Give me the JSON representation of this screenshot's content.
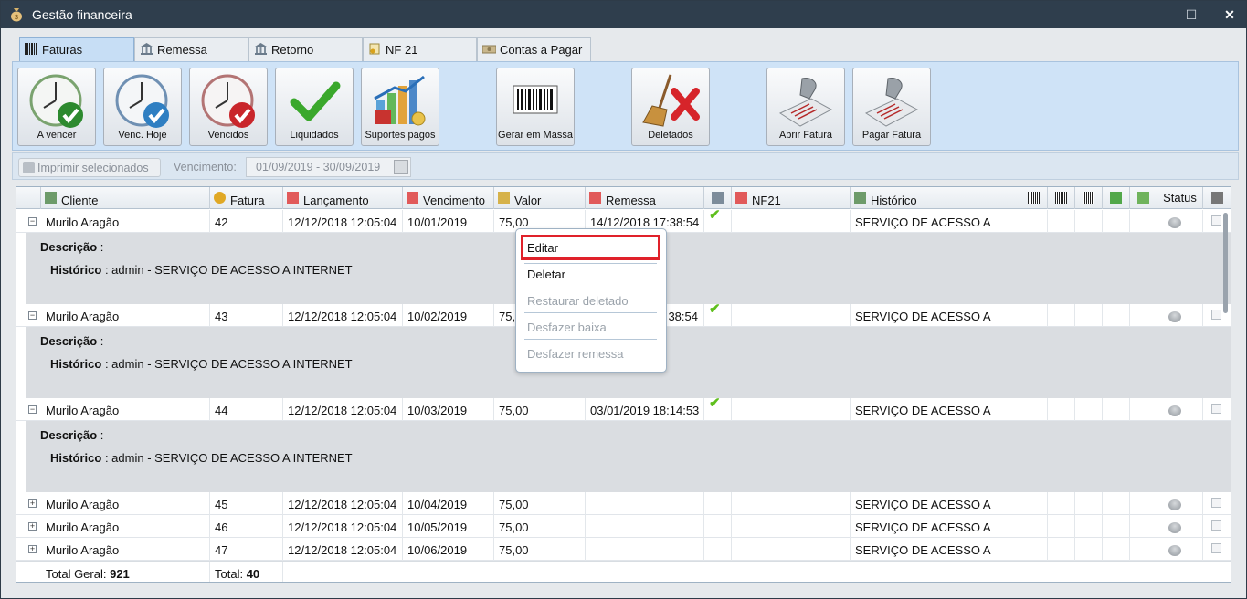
{
  "window": {
    "title": "Gestão financeira",
    "minimize": "—",
    "maximize": "☐",
    "close": "✕"
  },
  "tabs": [
    {
      "label": "Faturas",
      "active": true
    },
    {
      "label": "Remessa"
    },
    {
      "label": "Retorno"
    },
    {
      "label": "NF 21"
    },
    {
      "label": "Contas a Pagar"
    }
  ],
  "toolbar": {
    "a_vencer": "A vencer",
    "venc_hoje": "Venc. Hoje",
    "vencidos": "Vencidos",
    "liquidados": "Liquidados",
    "suportes_pagos": "Suportes pagos",
    "gerar_em_massa": "Gerar em Massa",
    "deletados": "Deletados",
    "abrir_fatura": "Abrir Fatura",
    "pagar_fatura": "Pagar Fatura"
  },
  "filter": {
    "print_label": "Imprimir selecionados",
    "vencimento_label": "Vencimento:",
    "vencimento_value": "01/09/2019 - 30/09/2019"
  },
  "columns": {
    "cliente": "Cliente",
    "fatura": "Fatura",
    "lancamento": "Lançamento",
    "vencimento": "Vencimento",
    "valor": "Valor",
    "remessa": "Remessa",
    "nf21": "NF21",
    "historico": "Histórico",
    "status": "Status"
  },
  "rows": [
    {
      "cliente": "Murilo Aragão",
      "fatura": "42",
      "lancamento": "12/12/2018 12:05:04",
      "vencimento": "10/01/2019",
      "valor": "75,00",
      "remessa": "14/12/2018 17:38:54",
      "historico": "SERVIÇO DE ACESSO A",
      "expanded": true
    },
    {
      "cliente": "Murilo Aragão",
      "fatura": "43",
      "lancamento": "12/12/2018 12:05:04",
      "vencimento": "10/02/2019",
      "valor": "75,",
      "remessa": "38:54",
      "historico": "SERVIÇO DE ACESSO A",
      "expanded": true
    },
    {
      "cliente": "Murilo Aragão",
      "fatura": "44",
      "lancamento": "12/12/2018 12:05:04",
      "vencimento": "10/03/2019",
      "valor": "75,00",
      "remessa": "03/01/2019 18:14:53",
      "historico": "SERVIÇO DE ACESSO A",
      "expanded": true
    },
    {
      "cliente": "Murilo Aragão",
      "fatura": "45",
      "lancamento": "12/12/2018 12:05:04",
      "vencimento": "10/04/2019",
      "valor": "75,00",
      "remessa": "",
      "historico": "SERVIÇO DE ACESSO A",
      "expanded": false
    },
    {
      "cliente": "Murilo Aragão",
      "fatura": "46",
      "lancamento": "12/12/2018 12:05:04",
      "vencimento": "10/05/2019",
      "valor": "75,00",
      "remessa": "",
      "historico": "SERVIÇO DE ACESSO A",
      "expanded": false
    },
    {
      "cliente": "Murilo Aragão",
      "fatura": "47",
      "lancamento": "12/12/2018 12:05:04",
      "vencimento": "10/06/2019",
      "valor": "75,00",
      "remessa": "",
      "historico": "SERVIÇO DE ACESSO A",
      "expanded": false
    }
  ],
  "detail": {
    "descricao_label": "Descrição",
    "sep": " :",
    "historico_label": "Histórico",
    "historico_value": " : admin - SERVIÇO DE ACESSO A INTERNET"
  },
  "footer": {
    "total_geral_label": "Total Geral: ",
    "total_geral_value": "921",
    "total_label": "Total: ",
    "total_value": "40"
  },
  "context_menu": {
    "editar": "Editar",
    "deletar": "Deletar",
    "restaurar": "Restaurar deletado",
    "desfazer_baixa": "Desfazer baixa",
    "desfazer_remessa": "Desfazer remessa"
  }
}
